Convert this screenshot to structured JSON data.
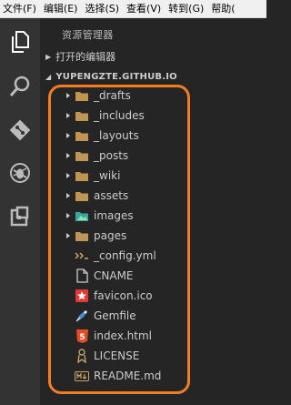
{
  "menu": [
    "文件(F)",
    "编辑(E)",
    "选择(S)",
    "查看(V)",
    "转到(G)",
    "帮助("
  ],
  "activity_icons": [
    "explorer-icon",
    "search-icon",
    "git-icon",
    "debug-icon",
    "extensions-icon"
  ],
  "sidebar": {
    "title": "资源管理器",
    "open_editors": "打开的编辑器",
    "root_folder": "YUPENGZTE.GITHUB.IO"
  },
  "tree": [
    {
      "label": "_drafts",
      "type": "folder",
      "icon": "folder-icon"
    },
    {
      "label": "_includes",
      "type": "folder",
      "icon": "folder-icon"
    },
    {
      "label": "_layouts",
      "type": "folder",
      "icon": "folder-icon"
    },
    {
      "label": "_posts",
      "type": "folder",
      "icon": "folder-icon"
    },
    {
      "label": "_wiki",
      "type": "folder",
      "icon": "folder-icon"
    },
    {
      "label": "assets",
      "type": "folder",
      "icon": "folder-icon"
    },
    {
      "label": "images",
      "type": "folder",
      "icon": "images-folder-icon"
    },
    {
      "label": "pages",
      "type": "folder",
      "icon": "folder-icon"
    },
    {
      "label": "_config.yml",
      "type": "file",
      "icon": "yml-icon"
    },
    {
      "label": "CNAME",
      "type": "file",
      "icon": "file-icon"
    },
    {
      "label": "favicon.ico",
      "type": "file",
      "icon": "favicon-icon"
    },
    {
      "label": "Gemfile",
      "type": "file",
      "icon": "gemfile-icon"
    },
    {
      "label": "index.html",
      "type": "file",
      "icon": "html5-icon"
    },
    {
      "label": "LICENSE",
      "type": "file",
      "icon": "license-icon"
    },
    {
      "label": "README.md",
      "type": "file",
      "icon": "markdown-icon"
    }
  ],
  "colors": {
    "highlight": "#f47d20",
    "folder": "#c09553",
    "activity_bg": "#333333",
    "sidebar_bg": "#252526"
  }
}
